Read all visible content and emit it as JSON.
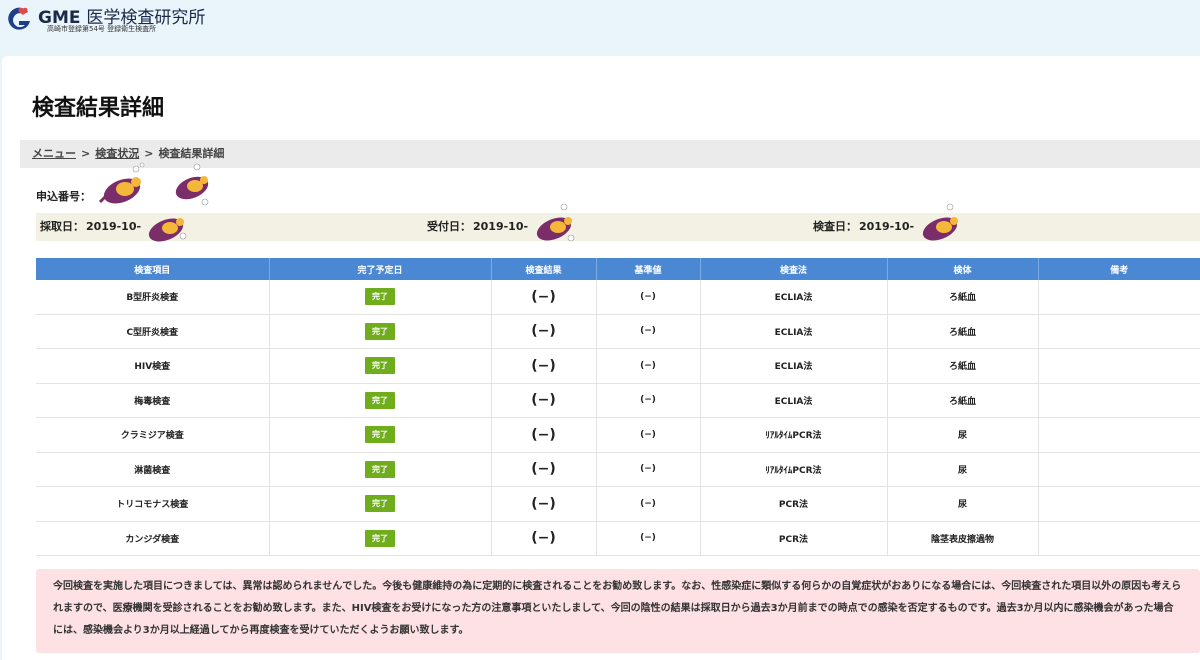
{
  "header": {
    "brand_strong": "GME",
    "brand_rest": "医学検査研究所",
    "subtitle": "高崎市登録第54号 登録衛生検査所"
  },
  "page": {
    "title": "検査結果詳細"
  },
  "breadcrumb": {
    "menu": "メニュー",
    "status": "検査状況",
    "current": "検査結果詳細",
    "separator": ">"
  },
  "application": {
    "label": "申込番号："
  },
  "dates": {
    "collected_label": "採取日：",
    "collected_value": "2019-10-",
    "received_label": "受付日：",
    "received_value": "2019-10-",
    "tested_label": "検査日：",
    "tested_value": "2019-10-"
  },
  "table": {
    "headers": [
      "検査項目",
      "完了予定日",
      "検査結果",
      "基準値",
      "検査法",
      "検体",
      "備考"
    ],
    "rows": [
      {
        "item": "B型肝炎検査",
        "status": "完了",
        "result": "(−)",
        "standard": "(−)",
        "method": "ECLIA法",
        "specimen": "ろ紙血",
        "note": ""
      },
      {
        "item": "C型肝炎検査",
        "status": "完了",
        "result": "(−)",
        "standard": "(−)",
        "method": "ECLIA法",
        "specimen": "ろ紙血",
        "note": ""
      },
      {
        "item": "HIV検査",
        "status": "完了",
        "result": "(−)",
        "standard": "(−)",
        "method": "ECLIA法",
        "specimen": "ろ紙血",
        "note": ""
      },
      {
        "item": "梅毒検査",
        "status": "完了",
        "result": "(−)",
        "standard": "(−)",
        "method": "ECLIA法",
        "specimen": "ろ紙血",
        "note": ""
      },
      {
        "item": "クラミジア検査",
        "status": "完了",
        "result": "(−)",
        "standard": "(−)",
        "method": "ﾘｱﾙﾀｲﾑPCR法",
        "specimen": "尿",
        "note": ""
      },
      {
        "item": "淋菌検査",
        "status": "完了",
        "result": "(−)",
        "standard": "(−)",
        "method": "ﾘｱﾙﾀｲﾑPCR法",
        "specimen": "尿",
        "note": ""
      },
      {
        "item": "トリコモナス検査",
        "status": "完了",
        "result": "(−)",
        "standard": "(−)",
        "method": "PCR法",
        "specimen": "尿",
        "note": ""
      },
      {
        "item": "カンジダ検査",
        "status": "完了",
        "result": "(−)",
        "standard": "(−)",
        "method": "PCR法",
        "specimen": "陰茎表皮擦過物",
        "note": ""
      }
    ]
  },
  "notice": {
    "text": "今回検査を実施した項目につきましては、異常は認められませんでした。今後も健康維持の為に定期的に検査されることをお勧め致します。なお、性感染症に類似する何らかの自覚症状がおありになる場合には、今回検査された項目以外の原因も考えられますので、医療機関を受診されることをお勧め致します。また、HIV検査をお受けになった方の注意事項といたしまして、今回の陰性の結果は採取日から過去3か月前までの時点での感染を否定するものです。過去3か月以内に感染機会があった場合には、感染機会より3か月以上経過してから再度検査を受けていただくようお願い致します。"
  },
  "colors": {
    "header_bg": "#eaf4fb",
    "table_header": "#4b88d3",
    "badge": "#6fad1c",
    "notice_bg": "#fde1e4",
    "date_bar": "#f3f1e4"
  },
  "icons": {
    "logo": "gme-g-logo-icon",
    "sticker": "sweet-potato-sticker-icon"
  }
}
